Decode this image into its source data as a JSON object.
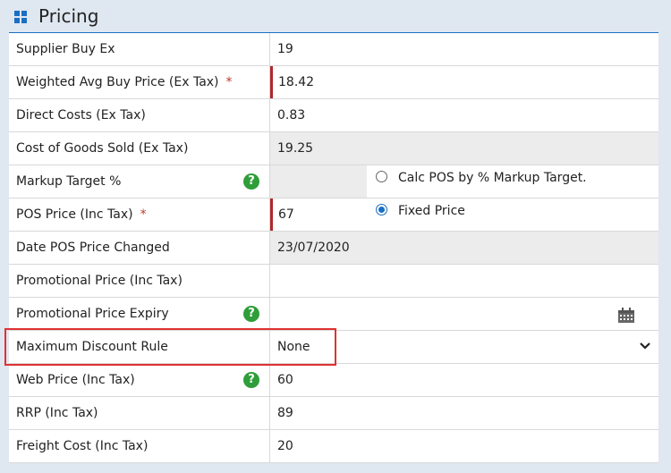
{
  "header": {
    "title": "Pricing",
    "icon": "grid-icon"
  },
  "rows": [
    {
      "label": "Supplier Buy Ex",
      "value": "19"
    },
    {
      "label": "Weighted Avg Buy Price (Ex Tax)",
      "required": "*",
      "value": "18.42"
    },
    {
      "label": "Direct Costs (Ex Tax)",
      "value": "0.83"
    },
    {
      "label": "Cost of Goods Sold (Ex Tax)",
      "value": "19.25"
    },
    {
      "label": "Markup Target %",
      "value": ""
    },
    {
      "label": "POS Price (Inc Tax)",
      "required": "*",
      "value": "67"
    },
    {
      "label": "Date POS Price Changed",
      "value": "23/07/2020"
    },
    {
      "label": "Promotional Price (Inc Tax)",
      "value": ""
    },
    {
      "label": "Promotional Price Expiry",
      "value": ""
    },
    {
      "label": "Maximum Discount Rule",
      "value": "None"
    },
    {
      "label": "Web Price (Inc Tax)",
      "value": "60"
    },
    {
      "label": "RRP (Inc Tax)",
      "value": "89"
    },
    {
      "label": "Freight Cost (Inc Tax)",
      "value": "20"
    }
  ],
  "pricing_mode": {
    "option_markup": "Calc POS by % Markup Target.",
    "option_fixed": "Fixed Price",
    "selected": "Fixed Price"
  },
  "help_icon_glyph": "?",
  "colors": {
    "accent": "#1a6fc2",
    "help": "#2f9e3a",
    "required": "#b0282b",
    "highlight": "#e03131"
  }
}
